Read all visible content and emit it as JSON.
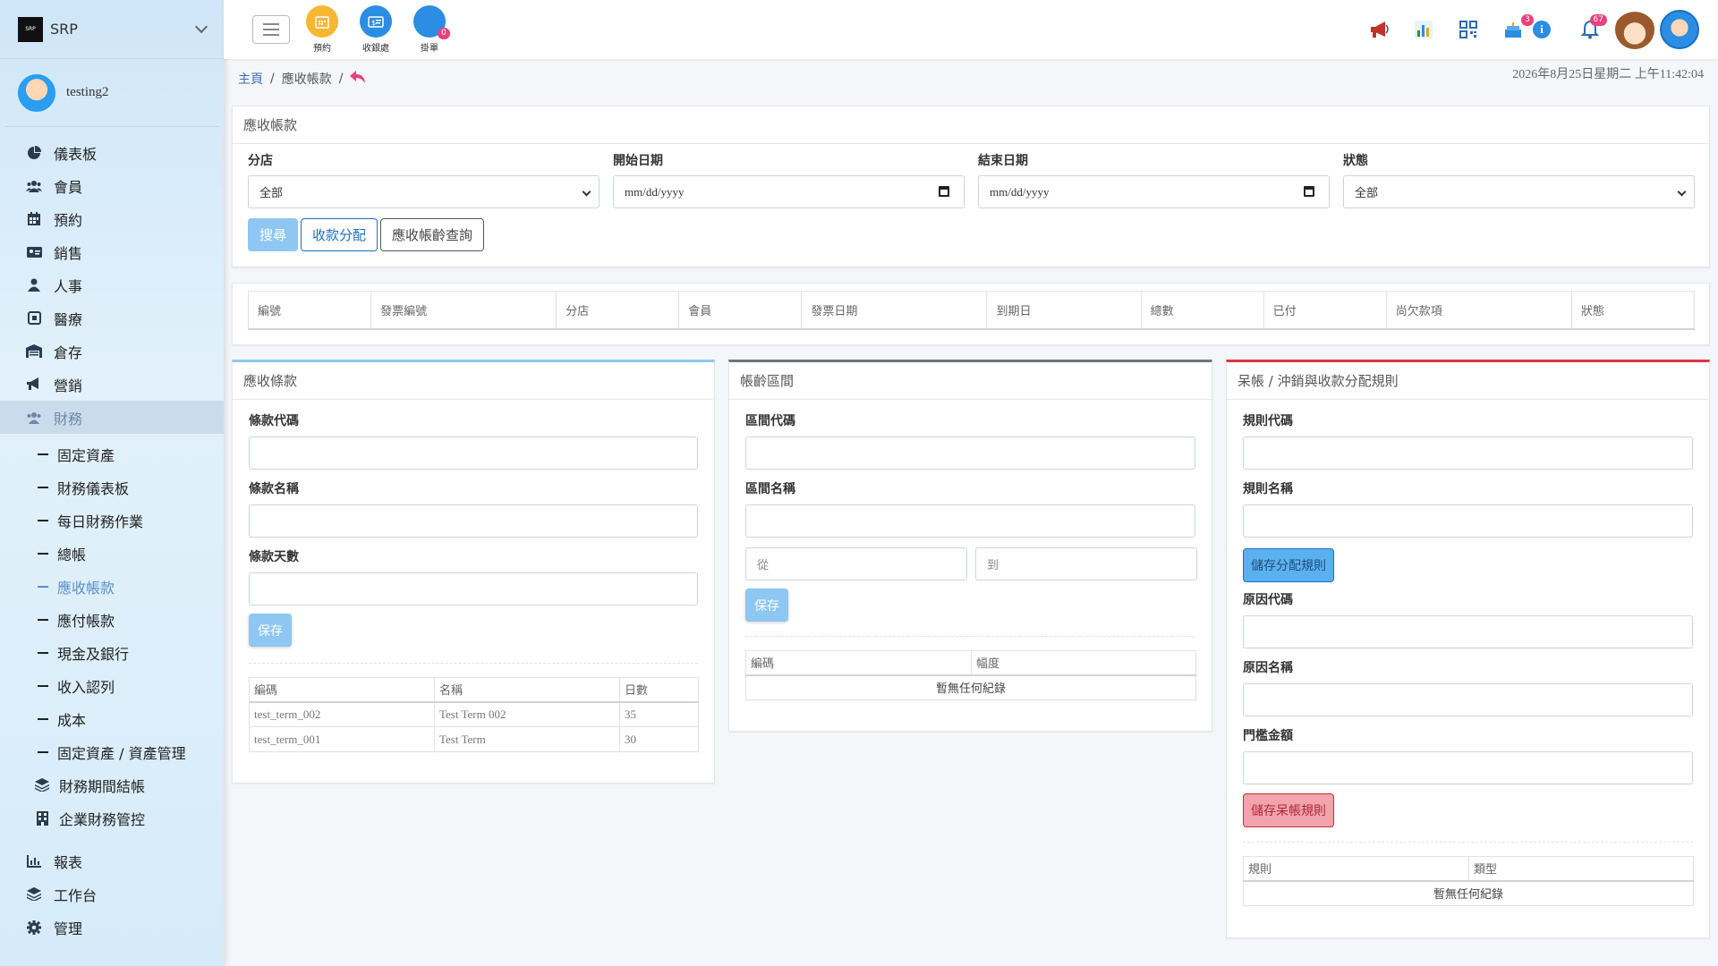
{
  "brand": {
    "name": "SRP",
    "logo_text": "SRP"
  },
  "user": {
    "name": "testing2"
  },
  "nav": {
    "items": [
      {
        "label": "儀表板",
        "icon": "chart-pie-icon"
      },
      {
        "label": "會員",
        "icon": "users-icon"
      },
      {
        "label": "預約",
        "icon": "calendar-icon"
      },
      {
        "label": "銷售",
        "icon": "id-card-icon"
      },
      {
        "label": "人事",
        "icon": "user-icon"
      },
      {
        "label": "醫療",
        "icon": "medical-icon"
      },
      {
        "label": "倉存",
        "icon": "warehouse-icon"
      },
      {
        "label": "營銷",
        "icon": "megaphone-icon"
      },
      {
        "label": "財務",
        "icon": "users-icon"
      }
    ],
    "sub_items": [
      {
        "label": "固定資產"
      },
      {
        "label": "財務儀表板"
      },
      {
        "label": "每日財務作業"
      },
      {
        "label": "總帳"
      },
      {
        "label": "應收帳款"
      },
      {
        "label": "應付帳款"
      },
      {
        "label": "現金及銀行"
      },
      {
        "label": "收入認列"
      },
      {
        "label": "成本"
      },
      {
        "label": "固定資產 / 資產管理"
      },
      {
        "label": "財務期間結帳",
        "icon": "layers-icon"
      },
      {
        "label": "企業財務管控",
        "icon": "building-icon"
      }
    ],
    "bottom_items": [
      {
        "label": "報表",
        "icon": "bar-chart-icon"
      },
      {
        "label": "工作台",
        "icon": "layers-icon"
      },
      {
        "label": "管理",
        "icon": "gear-icon"
      }
    ]
  },
  "topbar": {
    "quick": [
      {
        "label": "預約",
        "color": "#f7b733"
      },
      {
        "label": "收銀處",
        "color": "#2b8de3"
      },
      {
        "label": "掛單",
        "color": "#2b8de3",
        "badge": "0"
      }
    ],
    "badges": {
      "cake": "3",
      "bell": "67"
    }
  },
  "breadcrumb": {
    "home": "主頁",
    "current": "應收帳款"
  },
  "datetime": "2026年8月25日星期二 上午11:42:04",
  "filter": {
    "title": "應收帳款",
    "branch_label": "分店",
    "branch_value": "全部",
    "start_label": "開始日期",
    "start_placeholder": "mm/dd/yyyy",
    "end_label": "結束日期",
    "end_placeholder": "mm/dd/yyyy",
    "status_label": "狀態",
    "status_value": "全部",
    "search_btn": "搜尋",
    "alloc_btn": "收款分配",
    "aging_btn": "應收帳齡查詢"
  },
  "ar_table": {
    "columns": [
      "編號",
      "發票編號",
      "分店",
      "會員",
      "發票日期",
      "到期日",
      "總數",
      "已付",
      "尚欠款項",
      "狀態"
    ]
  },
  "terms": {
    "title": "應收條款",
    "code_label": "條款代碼",
    "name_label": "條款名稱",
    "days_label": "條款天數",
    "save_btn": "保存",
    "columns": [
      "編碼",
      "名稱",
      "日數"
    ],
    "rows": [
      [
        "test_term_002",
        "Test Term 002",
        "35"
      ],
      [
        "test_term_001",
        "Test Term",
        "30"
      ]
    ]
  },
  "aging": {
    "title": "帳齡區間",
    "code_label": "區間代碼",
    "name_label": "區間名稱",
    "from_placeholder": "從",
    "to_placeholder": "到",
    "save_btn": "保存",
    "columns": [
      "編碼",
      "幅度"
    ],
    "empty": "暫無任何紀錄"
  },
  "rules": {
    "title": "呆帳 / 沖銷與收款分配規則",
    "rule_code_label": "規則代碼",
    "rule_name_label": "規則名稱",
    "save_alloc_btn": "儲存分配規則",
    "reason_code_label": "原因代碼",
    "reason_name_label": "原因名稱",
    "threshold_label": "門檻金額",
    "save_bad_btn": "儲存呆帳規則",
    "columns": [
      "規則",
      "類型"
    ],
    "empty": "暫無任何紀錄"
  }
}
